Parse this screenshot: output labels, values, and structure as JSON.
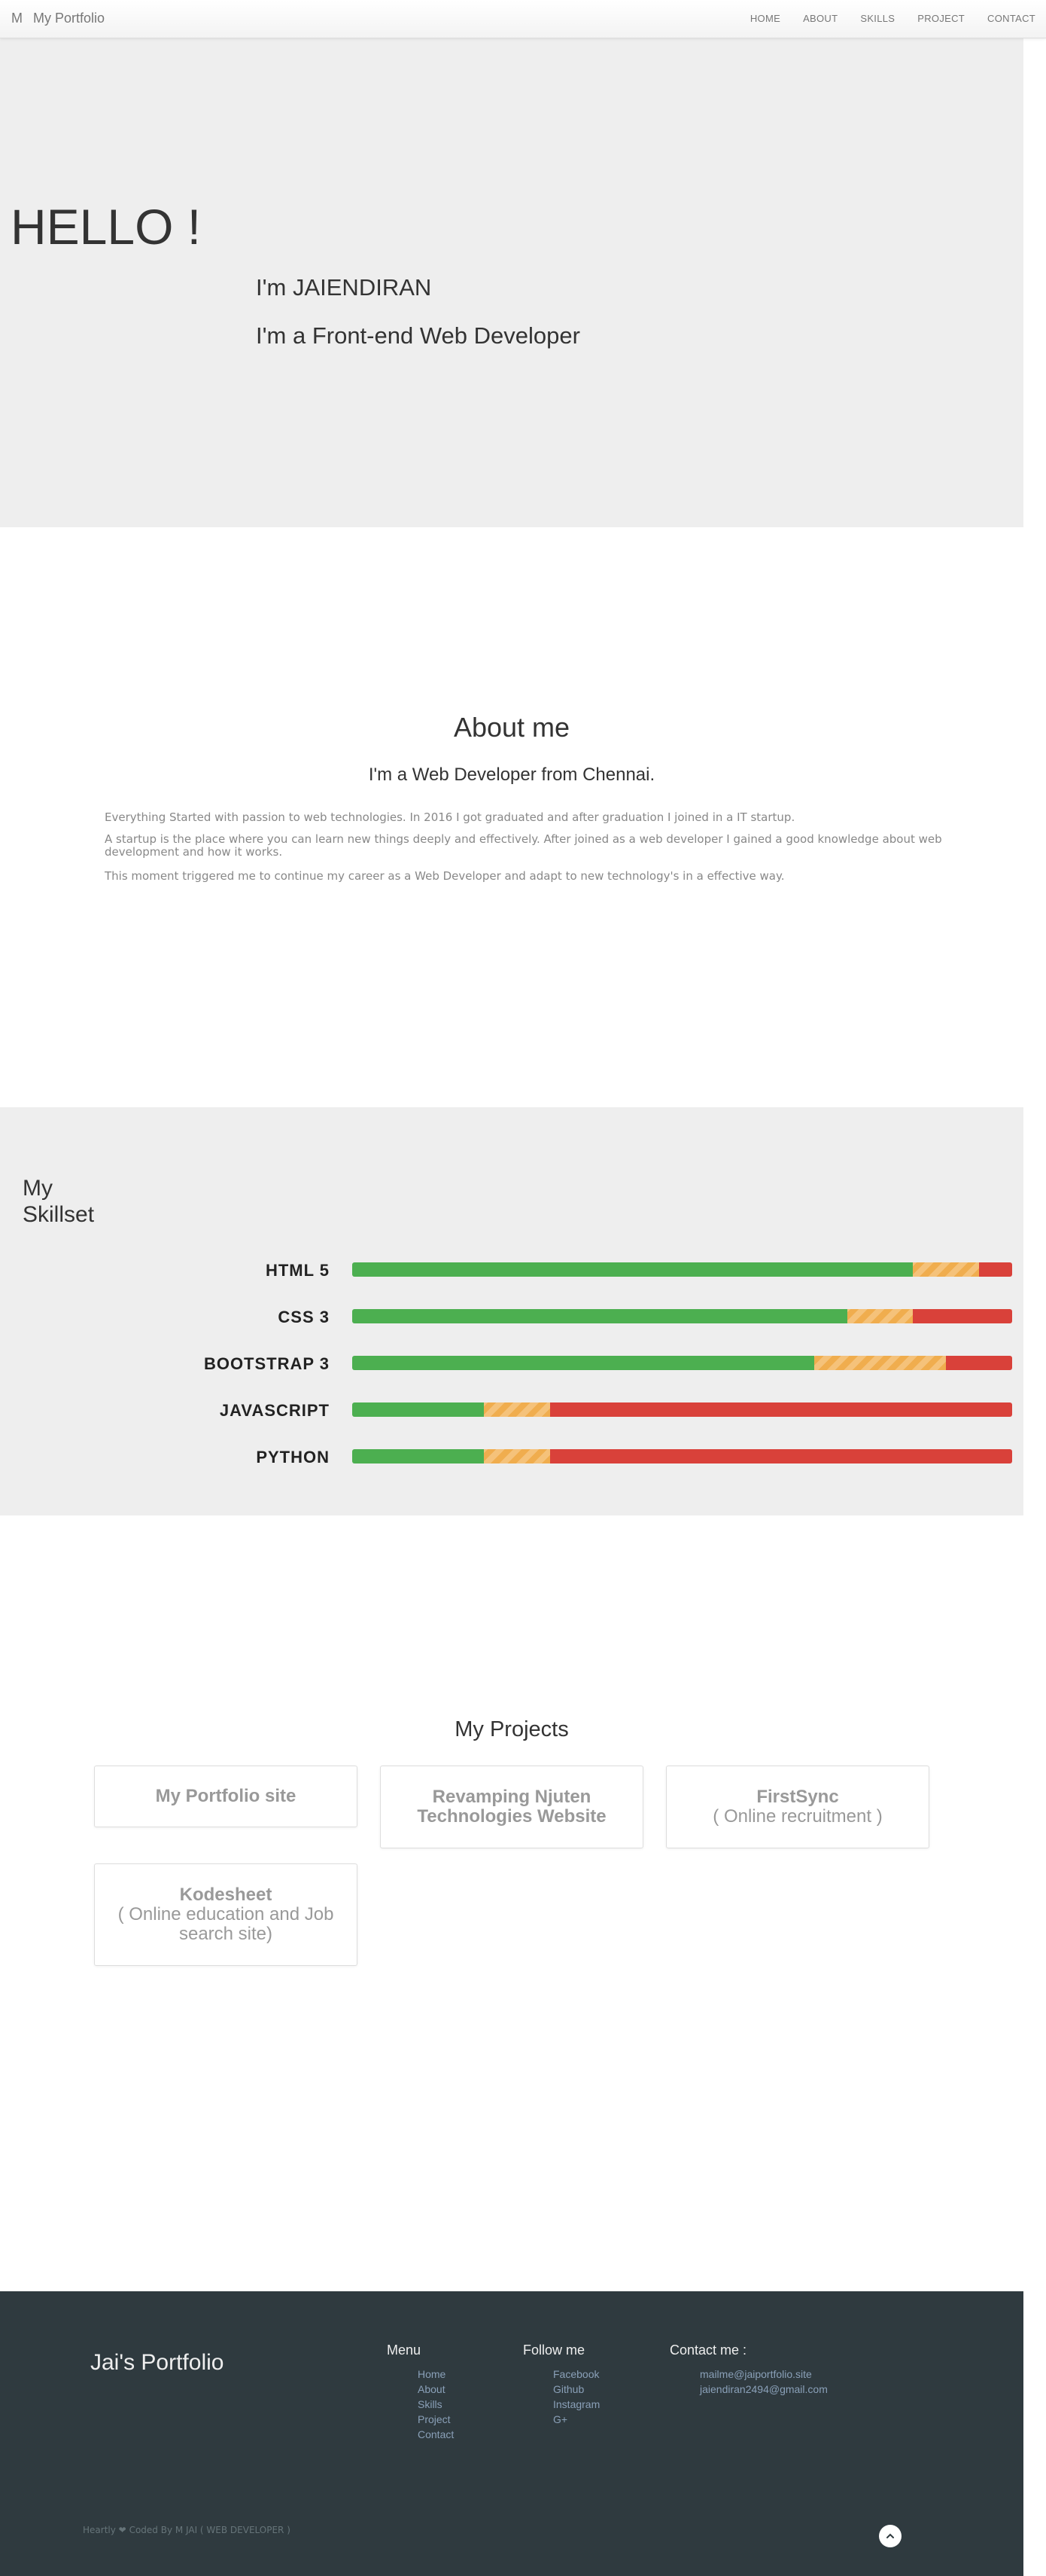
{
  "navbar": {
    "brand_mark": "M",
    "brand_name": "My Portfolio",
    "links": [
      "HOME",
      "ABOUT",
      "SKILLS",
      "PROJECT",
      "CONTACT"
    ]
  },
  "hero": {
    "greeting": "HELLO !",
    "name_line": "I'm JAIENDIRAN",
    "role_line": "I'm a Front-end Web Developer"
  },
  "about": {
    "title": "About me",
    "subtitle": "I'm a Web Developer from Chennai.",
    "paragraphs": [
      "Everything Started with passion to web technologies. In 2016 I got graduated and after graduation I joined in a IT startup.",
      "A startup is the place where you can learn new things deeply and effectively. After joined as a web developer I gained a good knowledge about web development and how it works.",
      "This moment triggered me to continue my career as a Web Developer and adapt to new technology's in a effective way."
    ]
  },
  "skills": {
    "title": "My Skillset",
    "items": [
      {
        "label": "HTML 5",
        "green": 85,
        "orange": 10
      },
      {
        "label": "CSS 3",
        "green": 75,
        "orange": 10
      },
      {
        "label": "BOOTSTRAP 3",
        "green": 70,
        "orange": 20
      },
      {
        "label": "JAVASCRIPT",
        "green": 20,
        "orange": 10
      },
      {
        "label": "PYTHON",
        "green": 20,
        "orange": 10
      }
    ],
    "colors": {
      "green": "#4caf50",
      "orange": "#f0ad4e",
      "red": "#d9413a"
    }
  },
  "projects": {
    "title": "My Projects",
    "cards": [
      {
        "title": "My Portfolio site",
        "sub": ""
      },
      {
        "title": "Revamping Njuten Technologies Website",
        "sub": ""
      },
      {
        "title": "FirstSync",
        "sub": "( Online recruitment )"
      },
      {
        "title": "Kodesheet",
        "sub": "( Online education and Job search site)"
      }
    ]
  },
  "footer": {
    "brand": "Jai's Portfolio",
    "menu_title": "Menu",
    "menu_items": [
      "Home",
      "About",
      "Skills",
      "Project",
      "Contact"
    ],
    "follow_title": "Follow me",
    "follow_items": [
      "Facebook",
      "Github",
      "Instagram",
      "G+"
    ],
    "contact_title": "Contact me :",
    "contact_items": [
      "mailme@jaiportfolio.site",
      "jaiendiran2494@gmail.com"
    ],
    "credit_prefix": "Heartly",
    "credit_suffix": "Coded By M JAI ( WEB DEVELOPER )"
  }
}
